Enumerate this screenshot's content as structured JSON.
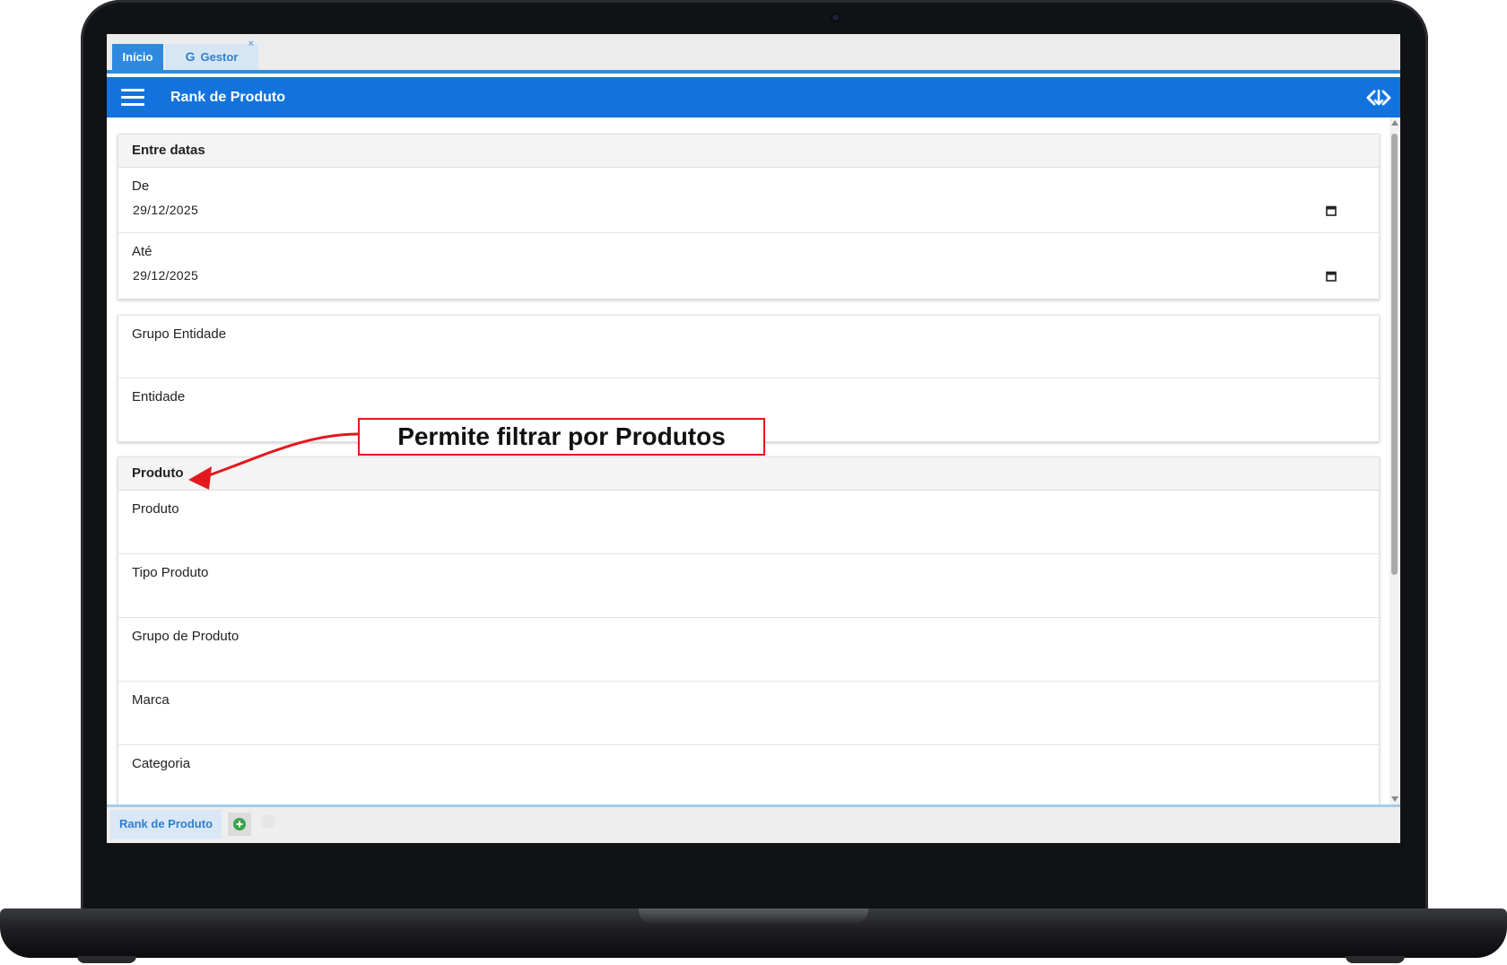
{
  "tabs": [
    {
      "label": "Início",
      "active": true
    },
    {
      "label": "Gestor",
      "active": false,
      "close": "×"
    }
  ],
  "header": {
    "title": "Rank de Produto",
    "accent_color": "#1273de"
  },
  "filters": {
    "dates": {
      "title": "Entre datas",
      "from": {
        "label": "De",
        "value": "29/12/2025"
      },
      "to": {
        "label": "Até",
        "value": "29/12/2025"
      }
    },
    "entity": {
      "group": {
        "label": "Grupo Entidade",
        "value": ""
      },
      "entity": {
        "label": "Entidade",
        "value": ""
      }
    },
    "product": {
      "title": "Produto",
      "fields": [
        {
          "label": "Produto",
          "value": ""
        },
        {
          "label": "Tipo Produto",
          "value": ""
        },
        {
          "label": "Grupo de Produto",
          "value": ""
        },
        {
          "label": "Marca",
          "value": ""
        },
        {
          "label": "Categoria",
          "value": ""
        }
      ]
    }
  },
  "callout": {
    "text": "Permite filtrar por Produtos",
    "color": "#e3171d"
  },
  "bottom_tabs": [
    {
      "label": "Rank de Produto"
    }
  ],
  "icons": {
    "menu": "hamburger-icon",
    "swap": "code-swap-icon",
    "calendar": "calendar-icon",
    "add": "plus-circle-icon",
    "close": "close-circle-icon"
  }
}
